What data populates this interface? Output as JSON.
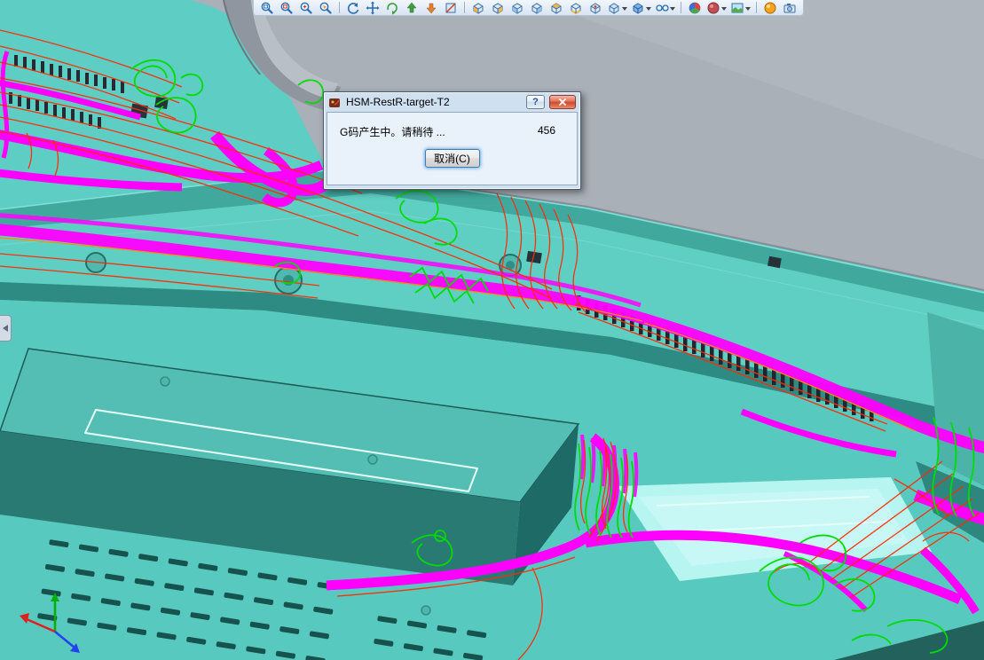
{
  "toolbar": {
    "icons": [
      "zoom-to-fit",
      "zoom-to-area",
      "zoom-in-out",
      "zoom-to-selection",
      "rotate-view",
      "pan",
      "roll-view",
      "view-up",
      "view-down",
      "section-view",
      "view-front",
      "view-back",
      "view-left",
      "view-right",
      "view-top",
      "view-bottom",
      "view-isometric",
      "view-orientation",
      "display-style",
      "hide-show-items",
      "apply-scene",
      "edit-appearance",
      "scene-background",
      "realview",
      "camera-view"
    ]
  },
  "dialog": {
    "title": "HSM-RestR-target-T2",
    "help_label": "?",
    "message": "G码产生中。请稍待 ...",
    "counter": "456",
    "cancel_label": "取消(C)"
  },
  "viewport": {
    "colors": {
      "background_gray": "#A9B0B8",
      "part_teal": "#5ECDC3",
      "toolpath_magenta": "#FF00FF",
      "toolpath_green": "#00DC00",
      "toolpath_red": "#FF2A00",
      "pocket_cyan": "#B7F5F0"
    },
    "triad_axes": [
      "x",
      "y",
      "z"
    ]
  }
}
